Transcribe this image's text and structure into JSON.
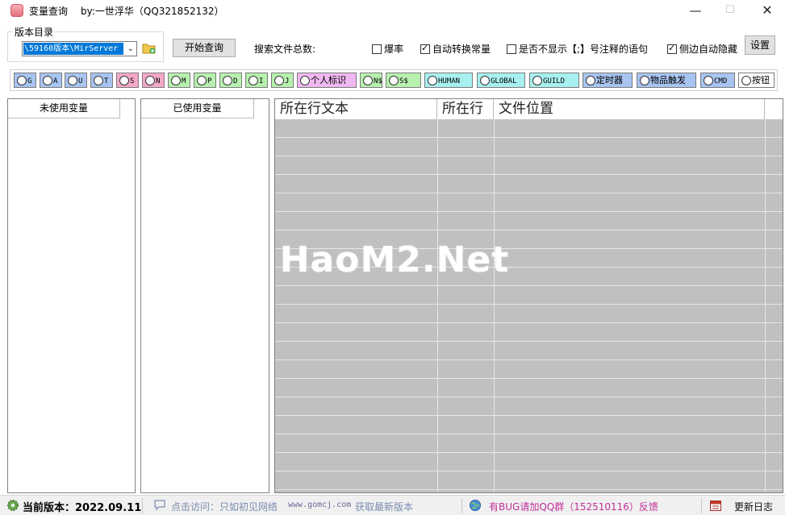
{
  "window": {
    "title": "变量查询",
    "author": "by:一世浮华（QQ321852132）",
    "minimize": "—",
    "maximize": "☐",
    "close": "✕"
  },
  "toolbar": {
    "group_label": "版本目录",
    "path_value": "\\59160版本\\MirServer",
    "start_button": "开始查询",
    "search_total_label": "搜索文件总数:",
    "checkboxes": [
      {
        "label": "爆率",
        "checked": false
      },
      {
        "label": "自动转换常量",
        "checked": true
      },
      {
        "label": "是否不显示【;】号注释的语句",
        "checked": false
      },
      {
        "label": "侧边自动隐藏",
        "checked": true
      }
    ],
    "settings_button": "设置"
  },
  "radio_filters": [
    {
      "label": "G",
      "color": "#a8c4f0"
    },
    {
      "label": "A",
      "color": "#a8c4f0"
    },
    {
      "label": "U",
      "color": "#a8c4f0"
    },
    {
      "label": "T",
      "color": "#a8c4f0"
    },
    {
      "label": "S",
      "color": "#f4a8c8"
    },
    {
      "label": "N",
      "color": "#f4a8c8"
    },
    {
      "label": "M",
      "color": "#b8f0b0"
    },
    {
      "label": "P",
      "color": "#b8f0b0"
    },
    {
      "label": "D",
      "color": "#b8f0b0"
    },
    {
      "label": "I",
      "color": "#b8f0b0"
    },
    {
      "label": "J",
      "color": "#b8f0b0"
    },
    {
      "label": "个人标识",
      "color": "#f0b8f0"
    },
    {
      "label": "N$",
      "color": "#b8f0b0"
    },
    {
      "label": "S$",
      "color": "#b8f0b0"
    },
    {
      "label": "HUMAN",
      "color": "#a8f0f0"
    },
    {
      "label": "GLOBAL",
      "color": "#a8f0f0"
    },
    {
      "label": "GUILD",
      "color": "#a8f0f0"
    },
    {
      "label": "定时器",
      "color": "#a8c4f0"
    },
    {
      "label": "物品触发",
      "color": "#a8c4f0"
    },
    {
      "label": "CMD",
      "color": "#a8c4f0"
    },
    {
      "label": "按钮",
      "color": "#ffffff"
    }
  ],
  "lists": {
    "unused_header": "未使用变量",
    "used_header": "已使用变量"
  },
  "grid": {
    "columns": [
      "所在行文本",
      "所在行",
      "文件位置"
    ],
    "watermark": "HaoM2.Net"
  },
  "status": {
    "version": "当前版本：2022.09.11",
    "visit": "点击访问：只如初见网络",
    "site": "www.gomcj.com",
    "latest": "获取最新版本",
    "bug": "有BUG请加QQ群（152510116）反馈",
    "changelog": "更新日志"
  }
}
